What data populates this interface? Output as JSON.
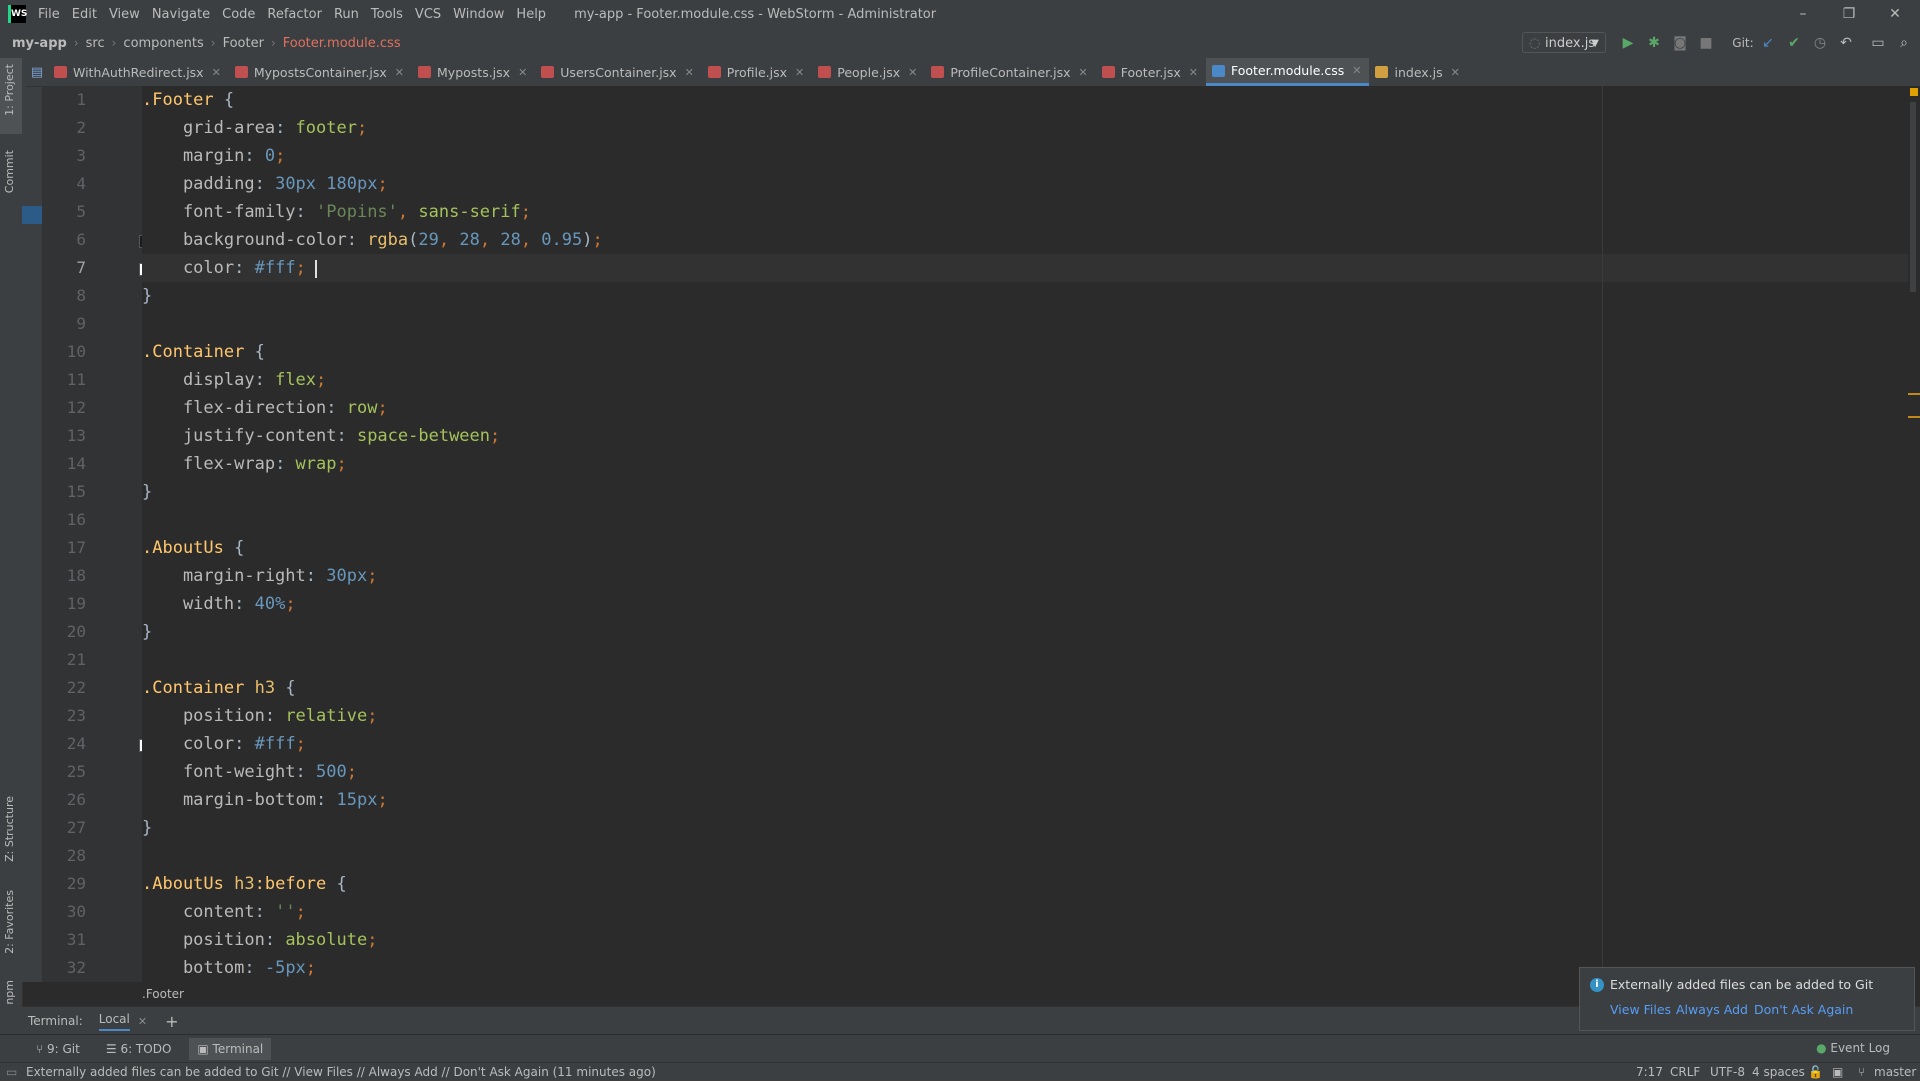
{
  "window": {
    "title": "my-app - Footer.module.css - WebStorm - Administrator",
    "logo": "WS",
    "menu": [
      "File",
      "Edit",
      "View",
      "Navigate",
      "Code",
      "Refactor",
      "Run",
      "Tools",
      "VCS",
      "Window",
      "Help"
    ],
    "controls": {
      "minimize": "–",
      "restore": "❐",
      "close": "✕"
    }
  },
  "breadcrumbs": [
    "my-app",
    "src",
    "components",
    "Footer",
    "Footer.module.css"
  ],
  "toolbar": {
    "run_config": "index.js",
    "git_label": "Git:"
  },
  "tabs": [
    {
      "label": "WithAuthRedirect.jsx",
      "color": "#c05050"
    },
    {
      "label": "MypostsContainer.jsx",
      "color": "#c05050"
    },
    {
      "label": "Myposts.jsx",
      "color": "#c05050"
    },
    {
      "label": "UsersContainer.jsx",
      "color": "#c05050"
    },
    {
      "label": "Profile.jsx",
      "color": "#c05050"
    },
    {
      "label": "People.jsx",
      "color": "#c05050"
    },
    {
      "label": "ProfileContainer.jsx",
      "color": "#c05050"
    },
    {
      "label": "Footer.jsx",
      "color": "#c05050"
    },
    {
      "label": "Footer.module.css",
      "color": "#4a88c7",
      "active": true
    },
    {
      "label": "index.js",
      "color": "#d0a040"
    }
  ],
  "left_strip": {
    "project": "1: Project",
    "commit": "Commit",
    "structure": "Z: Structure",
    "favorites": "2: Favorites",
    "npm": "npm"
  },
  "code": [
    [
      {
        "t": ".Footer",
        "c": "sel"
      },
      {
        "t": " {",
        "c": "brace"
      }
    ],
    [
      {
        "t": "    grid-area",
        "c": "prop"
      },
      {
        "t": ": ",
        "c": "brace"
      },
      {
        "t": "footer",
        "c": "val"
      },
      {
        "t": ";",
        "c": "punct"
      }
    ],
    [
      {
        "t": "    margin",
        "c": "prop"
      },
      {
        "t": ": ",
        "c": "brace"
      },
      {
        "t": "0",
        "c": "num"
      },
      {
        "t": ";",
        "c": "punct"
      }
    ],
    [
      {
        "t": "    padding",
        "c": "prop"
      },
      {
        "t": ": ",
        "c": "brace"
      },
      {
        "t": "30px",
        "c": "num"
      },
      {
        "t": " ",
        "c": "brace"
      },
      {
        "t": "180px",
        "c": "num"
      },
      {
        "t": ";",
        "c": "punct"
      }
    ],
    [
      {
        "t": "    font-family",
        "c": "prop"
      },
      {
        "t": ": ",
        "c": "brace"
      },
      {
        "t": "'Popins'",
        "c": "str"
      },
      {
        "t": ", ",
        "c": "punct"
      },
      {
        "t": "sans-serif",
        "c": "val"
      },
      {
        "t": ";",
        "c": "punct"
      }
    ],
    [
      {
        "t": "    background-color",
        "c": "prop"
      },
      {
        "t": ": ",
        "c": "brace"
      },
      {
        "t": "rgba",
        "c": "tag"
      },
      {
        "t": "(",
        "c": "brace"
      },
      {
        "t": "29",
        "c": "num"
      },
      {
        "t": ", ",
        "c": "punct"
      },
      {
        "t": "28",
        "c": "num"
      },
      {
        "t": ", ",
        "c": "punct"
      },
      {
        "t": "28",
        "c": "num"
      },
      {
        "t": ", ",
        "c": "punct"
      },
      {
        "t": "0.95",
        "c": "num"
      },
      {
        "t": ")",
        "c": "brace"
      },
      {
        "t": ";",
        "c": "punct"
      }
    ],
    [
      {
        "t": "    color",
        "c": "prop"
      },
      {
        "t": ": ",
        "c": "brace"
      },
      {
        "t": "#fff",
        "c": "num"
      },
      {
        "t": ";",
        "c": "punct"
      }
    ],
    [
      {
        "t": "}",
        "c": "brace"
      }
    ],
    [],
    [
      {
        "t": ".Container",
        "c": "sel"
      },
      {
        "t": " {",
        "c": "brace"
      }
    ],
    [
      {
        "t": "    display",
        "c": "prop"
      },
      {
        "t": ": ",
        "c": "brace"
      },
      {
        "t": "flex",
        "c": "val"
      },
      {
        "t": ";",
        "c": "punct"
      }
    ],
    [
      {
        "t": "    flex-direction",
        "c": "prop"
      },
      {
        "t": ": ",
        "c": "brace"
      },
      {
        "t": "row",
        "c": "val"
      },
      {
        "t": ";",
        "c": "punct"
      }
    ],
    [
      {
        "t": "    justify-content",
        "c": "prop"
      },
      {
        "t": ": ",
        "c": "brace"
      },
      {
        "t": "space-between",
        "c": "val"
      },
      {
        "t": ";",
        "c": "punct"
      }
    ],
    [
      {
        "t": "    flex-wrap",
        "c": "prop"
      },
      {
        "t": ": ",
        "c": "brace"
      },
      {
        "t": "wrap",
        "c": "val"
      },
      {
        "t": ";",
        "c": "punct"
      }
    ],
    [
      {
        "t": "}",
        "c": "brace"
      }
    ],
    [],
    [
      {
        "t": ".AboutUs",
        "c": "sel"
      },
      {
        "t": " {",
        "c": "brace"
      }
    ],
    [
      {
        "t": "    margin-right",
        "c": "prop"
      },
      {
        "t": ": ",
        "c": "brace"
      },
      {
        "t": "30px",
        "c": "num"
      },
      {
        "t": ";",
        "c": "punct"
      }
    ],
    [
      {
        "t": "    width",
        "c": "prop"
      },
      {
        "t": ": ",
        "c": "brace"
      },
      {
        "t": "40%",
        "c": "num"
      },
      {
        "t": ";",
        "c": "punct"
      }
    ],
    [
      {
        "t": "}",
        "c": "brace"
      }
    ],
    [],
    [
      {
        "t": ".Container",
        "c": "sel"
      },
      {
        "t": " ",
        "c": "brace"
      },
      {
        "t": "h3",
        "c": "tag"
      },
      {
        "t": " {",
        "c": "brace"
      }
    ],
    [
      {
        "t": "    position",
        "c": "prop"
      },
      {
        "t": ": ",
        "c": "brace"
      },
      {
        "t": "relative",
        "c": "val"
      },
      {
        "t": ";",
        "c": "punct"
      }
    ],
    [
      {
        "t": "    color",
        "c": "prop"
      },
      {
        "t": ": ",
        "c": "brace"
      },
      {
        "t": "#fff",
        "c": "num"
      },
      {
        "t": ";",
        "c": "punct"
      }
    ],
    [
      {
        "t": "    font-weight",
        "c": "prop"
      },
      {
        "t": ": ",
        "c": "brace"
      },
      {
        "t": "500",
        "c": "num"
      },
      {
        "t": ";",
        "c": "punct"
      }
    ],
    [
      {
        "t": "    margin-bottom",
        "c": "prop"
      },
      {
        "t": ": ",
        "c": "brace"
      },
      {
        "t": "15px",
        "c": "num"
      },
      {
        "t": ";",
        "c": "punct"
      }
    ],
    [
      {
        "t": "}",
        "c": "brace"
      }
    ],
    [],
    [
      {
        "t": ".AboutUs",
        "c": "sel"
      },
      {
        "t": " ",
        "c": "brace"
      },
      {
        "t": "h3",
        "c": "tag"
      },
      {
        "t": ":before",
        "c": "sel"
      },
      {
        "t": " {",
        "c": "brace"
      }
    ],
    [
      {
        "t": "    content",
        "c": "prop"
      },
      {
        "t": ": ",
        "c": "brace"
      },
      {
        "t": "''",
        "c": "str"
      },
      {
        "t": ";",
        "c": "punct"
      }
    ],
    [
      {
        "t": "    position",
        "c": "prop"
      },
      {
        "t": ": ",
        "c": "brace"
      },
      {
        "t": "absolute",
        "c": "val"
      },
      {
        "t": ";",
        "c": "punct"
      }
    ],
    [
      {
        "t": "    bottom",
        "c": "prop"
      },
      {
        "t": ": ",
        "c": "brace"
      },
      {
        "t": "-5px",
        "c": "num"
      },
      {
        "t": ";",
        "c": "punct"
      }
    ]
  ],
  "color_swatches": [
    {
      "line": 6,
      "color": "#1d1c1c"
    },
    {
      "line": 7,
      "color": "#ffffff"
    },
    {
      "line": 24,
      "color": "#ffffff"
    }
  ],
  "editor_breadcrumb": ".Footer",
  "terminal": {
    "label": "Terminal:",
    "tab": "Local",
    "add": "+"
  },
  "tool_windows": [
    {
      "label": "9: Git",
      "icon": "git-icon"
    },
    {
      "label": "6: TODO",
      "icon": "todo-icon"
    },
    {
      "label": "Terminal",
      "icon": "terminal-icon",
      "active": true
    }
  ],
  "event_log": "Event Log",
  "notification": {
    "text": "Externally added files can be added to Git",
    "actions": [
      "View Files",
      "Always Add",
      "Don't Ask Again"
    ]
  },
  "status": {
    "message": "Externally added files can be added to Git // View Files // Always Add // Don't Ask Again (11 minutes ago)",
    "position": "7:17",
    "line_sep": "CRLF",
    "encoding": "UTF-8",
    "indent": "4 spaces",
    "branch": "master"
  }
}
